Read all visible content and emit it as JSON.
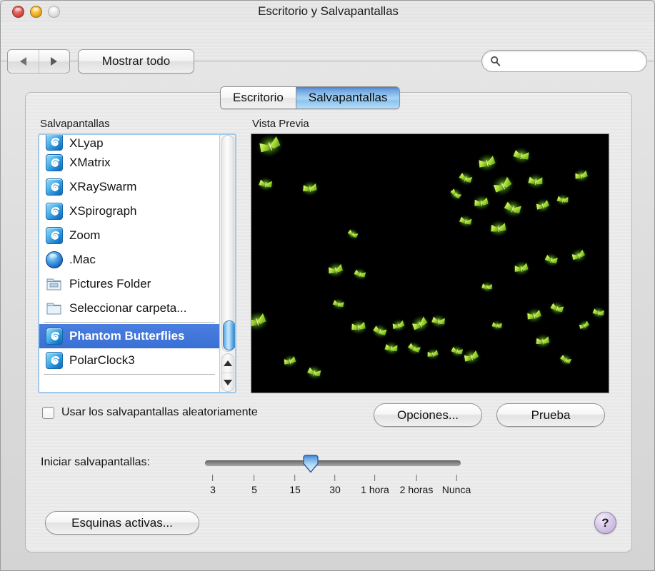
{
  "window": {
    "title": "Escritorio y Salvapantallas",
    "controls": {
      "close": "close-button",
      "minimize": "minimize-button",
      "zoom": "zoom-button"
    }
  },
  "toolbar": {
    "back_label": "",
    "forward_label": "",
    "show_all_label": "Mostrar todo",
    "search": {
      "value": "",
      "placeholder": ""
    }
  },
  "tabs": [
    {
      "label": "Escritorio",
      "active": false
    },
    {
      "label": "Salvapantallas",
      "active": true
    }
  ],
  "saver_section": {
    "label": "Salvapantallas",
    "items": [
      {
        "label": "XLyap",
        "icon": "screensaver-swirl-icon",
        "selected": false,
        "clipped": true
      },
      {
        "label": "XMatrix",
        "icon": "screensaver-swirl-icon",
        "selected": false
      },
      {
        "label": "XRaySwarm",
        "icon": "screensaver-swirl-icon",
        "selected": false
      },
      {
        "label": "XSpirograph",
        "icon": "screensaver-swirl-icon",
        "selected": false
      },
      {
        "label": "Zoom",
        "icon": "screensaver-swirl-icon",
        "selected": false
      },
      {
        "label": ".Mac",
        "icon": "globe-icon",
        "selected": false
      },
      {
        "label": "Pictures Folder",
        "icon": "folder-icon",
        "selected": false
      },
      {
        "label": "Seleccionar carpeta...",
        "icon": "folder-icon",
        "selected": false
      },
      {
        "separator": true
      },
      {
        "label": "Phantom Butterflies",
        "icon": "screensaver-swirl-icon",
        "selected": true
      },
      {
        "label": "PolarClock3",
        "icon": "screensaver-swirl-icon",
        "selected": false
      },
      {
        "separator": true
      }
    ],
    "selected_item": "Phantom Butterflies"
  },
  "preview": {
    "label": "Vista Previa",
    "background_color": "#000000",
    "butterfly_colors": {
      "core": "#f2f7a0",
      "mid": "#8fd832",
      "glow": "#3f8f12"
    },
    "content_description": "Phantom Butterflies screensaver: glowing green and yellow butterflies on black"
  },
  "random_checkbox": {
    "label": "Usar los salvapantallas aleatoriamente",
    "checked": false
  },
  "buttons": {
    "options": "Opciones...",
    "test": "Prueba",
    "hot_corners": "Esquinas activas...",
    "help": "?"
  },
  "slider": {
    "label": "Iniciar salvapantallas:",
    "ticks": [
      "3",
      "5",
      "15",
      "30",
      "1 hora",
      "2 horas",
      "Nunca"
    ],
    "value_index": 2.4,
    "thumb_position_percent": 40
  },
  "colors": {
    "accent": "#3a6fd4",
    "tab_active": "#8cc5f0",
    "help_button": "#bda8da",
    "window_bg": "#e8e8e8"
  }
}
